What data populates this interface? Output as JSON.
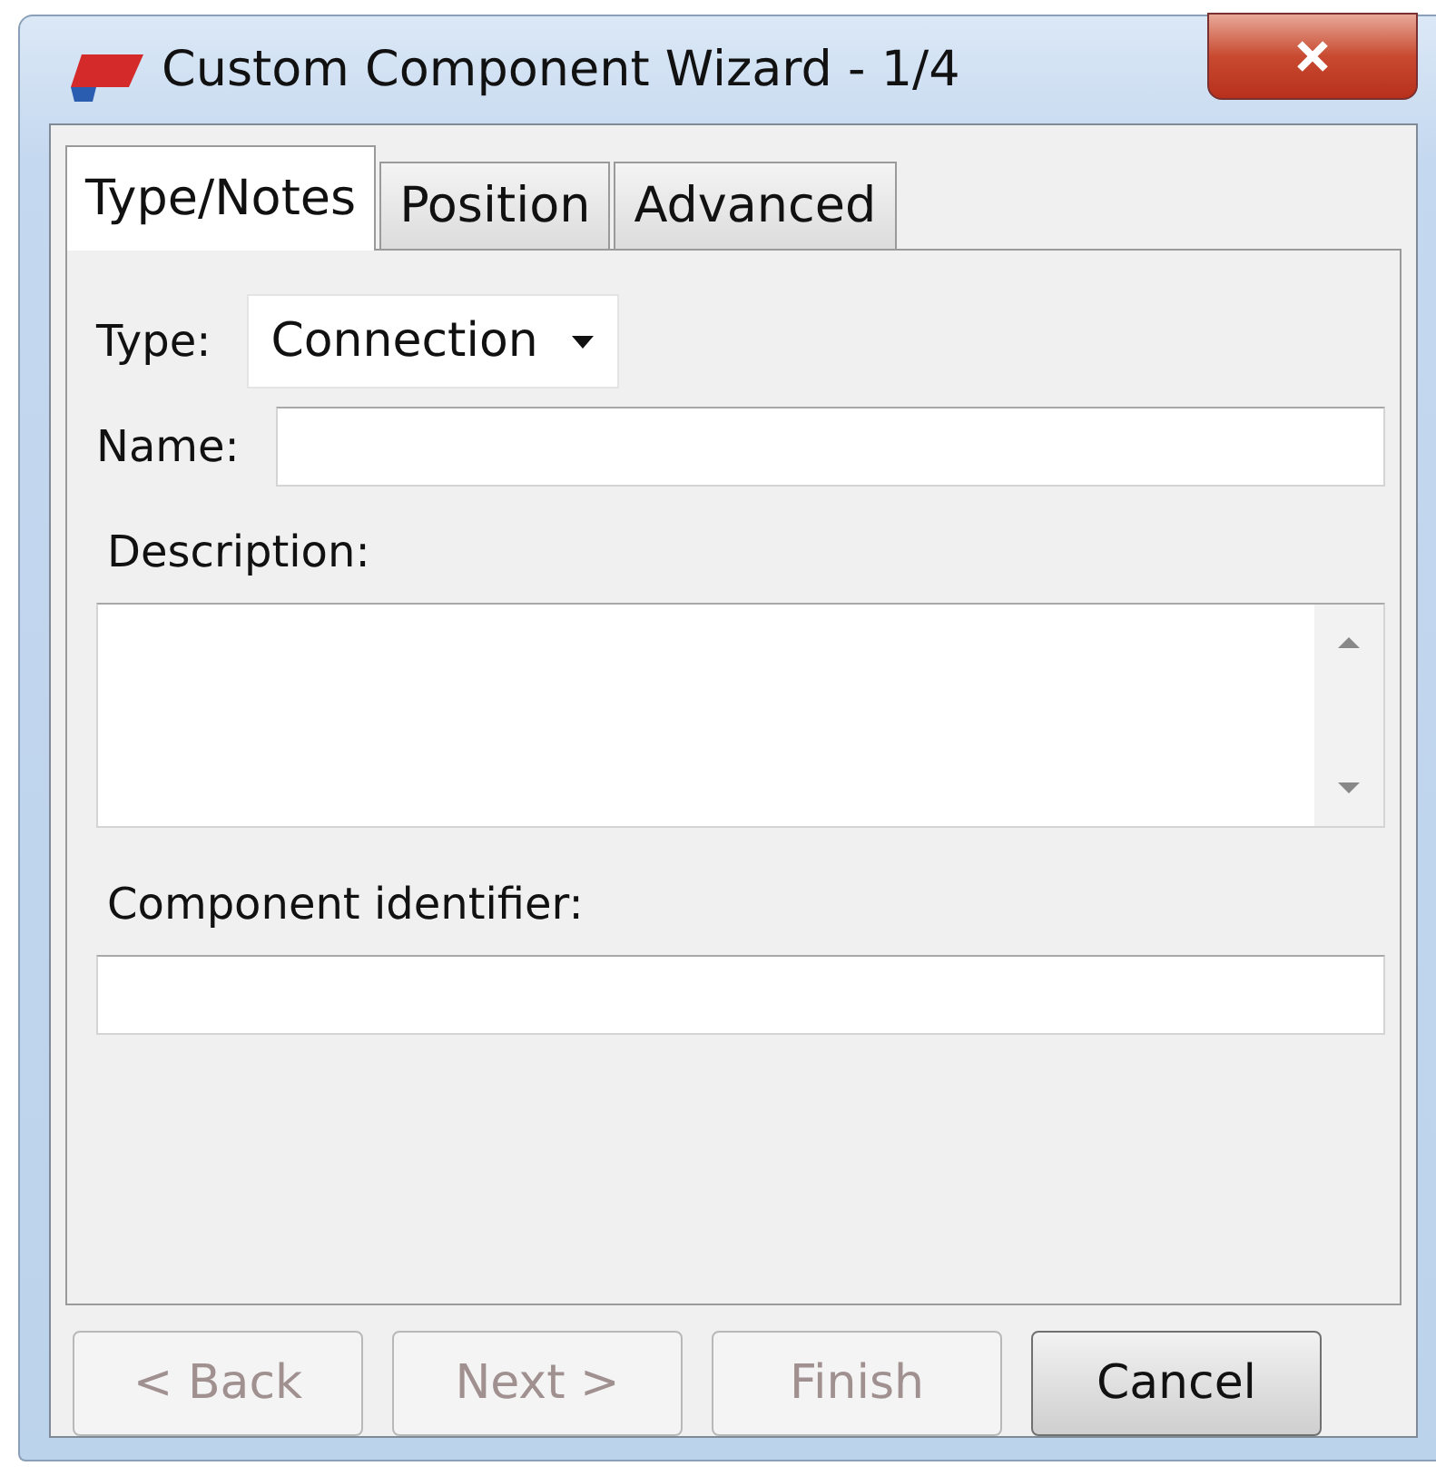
{
  "window": {
    "title": "Custom Component Wizard - 1/4"
  },
  "tabs": [
    {
      "label": "Type/Notes",
      "selected": true
    },
    {
      "label": "Position",
      "selected": false
    },
    {
      "label": "Advanced",
      "selected": false
    }
  ],
  "type_field": {
    "label": "Type:",
    "value": "Connection"
  },
  "name_field": {
    "label": "Name:"
  },
  "description": {
    "label": "Description:"
  },
  "identifier": {
    "label": "Component identifier:"
  },
  "buttons": [
    {
      "label": "< Back",
      "disabled": true
    },
    {
      "label": "Next >",
      "disabled": true
    },
    {
      "label": "Finish",
      "disabled": true
    },
    {
      "label": "Cancel",
      "disabled": false
    }
  ]
}
